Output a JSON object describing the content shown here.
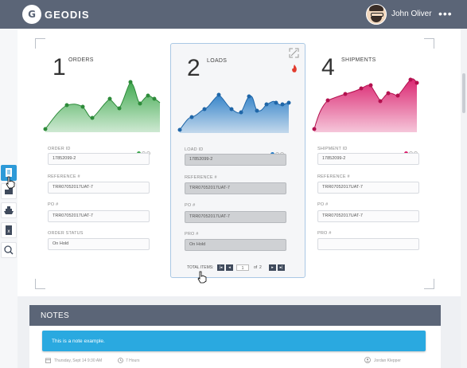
{
  "header": {
    "logo_glyph": "G",
    "brand": "GEODIS",
    "user_name": "John Oliver",
    "more_glyph": "•••"
  },
  "rail_icons": [
    "document-icon",
    "boxes-icon",
    "ship-icon",
    "excel-icon",
    "search-icon"
  ],
  "cards": [
    {
      "number": "1",
      "title": "ORDERS",
      "color": "#3aa64a",
      "fields": [
        {
          "label": "ORDER ID",
          "value": "17852099-2"
        },
        {
          "label": "REFERENCE #",
          "value": "TRR07052017UAT-7"
        },
        {
          "label": "PO #",
          "value": "TRR07052017UAT-7"
        },
        {
          "label": "ORDER STATUS",
          "value": "On Hold"
        }
      ]
    },
    {
      "number": "2",
      "title": "LOADS",
      "color": "#2d7fc7",
      "fields": [
        {
          "label": "LOAD ID",
          "value": "17852099-2"
        },
        {
          "label": "REFERENCE #",
          "value": "TRR07052017UAT-7"
        },
        {
          "label": "PO #",
          "value": "TRR07052017UAT-7"
        },
        {
          "label": "PRO #",
          "value": "On Hold"
        }
      ],
      "pager": {
        "label": "TOTAL ITEMS:",
        "page": "1",
        "of": "of",
        "total": "2"
      }
    },
    {
      "number": "4",
      "title": "SHIPMENTS",
      "color": "#d91c6a",
      "fields": [
        {
          "label": "SHIPMENT ID",
          "value": "17852099-2"
        },
        {
          "label": "REFERENCE #",
          "value": "TRR07052017UAT-7"
        },
        {
          "label": "PO #",
          "value": "TRR07052017UAT-7"
        },
        {
          "label": "PRO #",
          "value": ""
        }
      ]
    }
  ],
  "notes": {
    "title": "NOTES",
    "message": "This is a note example.",
    "date": "Thursday, Sept 14 9:30 AM",
    "duration": "7 Hours",
    "author": "Jordan Klepper"
  }
}
